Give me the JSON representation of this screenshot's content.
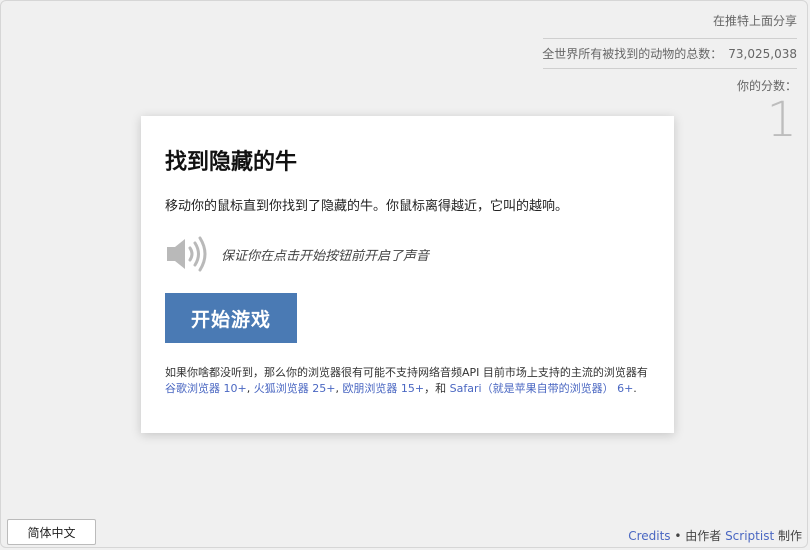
{
  "header": {
    "share_link": "在推特上面分享",
    "total_label": "全世界所有被找到的动物的总数：",
    "total_value": "73,025,038",
    "score_label": "你的分数：",
    "score_value": "1"
  },
  "card": {
    "title": "找到隐藏的牛",
    "instruction": "移动你的鼠标直到你找到了隐藏的牛。你鼠标离得越近，它叫的越响。",
    "sound_note": "保证你在点击开始按钮前开启了声音",
    "start_button": "开始游戏",
    "browser_note": {
      "intro": "如果你啥都没听到，那么你的浏览器很有可能不支持网络音频API 目前市场上支持的主流的浏览器有",
      "links": [
        "谷歌浏览器 10+",
        "火狐浏览器 25+",
        "欧朋浏览器 15+",
        "Safari（就是苹果自带的浏览器） 6+"
      ],
      "sep1": ", ",
      "sep2": ", ",
      "sep3": "，和 ",
      "end": "."
    }
  },
  "footer": {
    "language_button": "简体中文",
    "credits_link": "Credits",
    "credits_mid": " • 由作者 ",
    "author_link": "Scriptist",
    "credits_end": " 制作"
  },
  "icons": {
    "speaker": "speaker-icon"
  },
  "colors": {
    "button": "#4a7ab4",
    "link": "#4a67c2",
    "background": "#f0f0f0"
  }
}
